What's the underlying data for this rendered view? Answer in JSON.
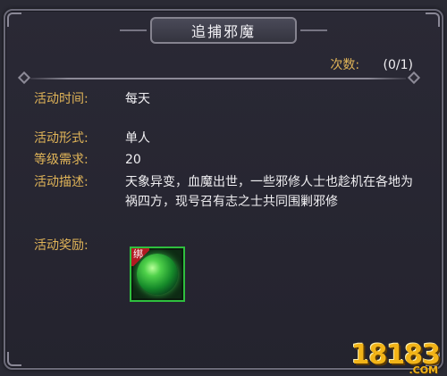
{
  "title": "追捕邪魔",
  "count": {
    "label": "次数:",
    "value": "(0/1)"
  },
  "fields": {
    "time_label": "活动时间:",
    "time_value": "每天",
    "form_label": "活动形式:",
    "form_value": "单人",
    "level_label": "等级需求:",
    "level_value": "20",
    "desc_label": "活动描述:",
    "desc_value": "天象异变，血魔出世，一些邪修人士也趁机在各地为祸四方，现号召有志之士共同围剿邪修",
    "reward_label": "活动奖励:"
  },
  "reward_item": {
    "bind_tag": "绑",
    "icon": "green-orb-icon",
    "border_color": "#2fbf3e"
  },
  "watermark": {
    "main": "18183",
    "sub": ".COM"
  },
  "colors": {
    "label": "#e0b458",
    "value": "#f0eff2",
    "panel": "#2a2935"
  }
}
